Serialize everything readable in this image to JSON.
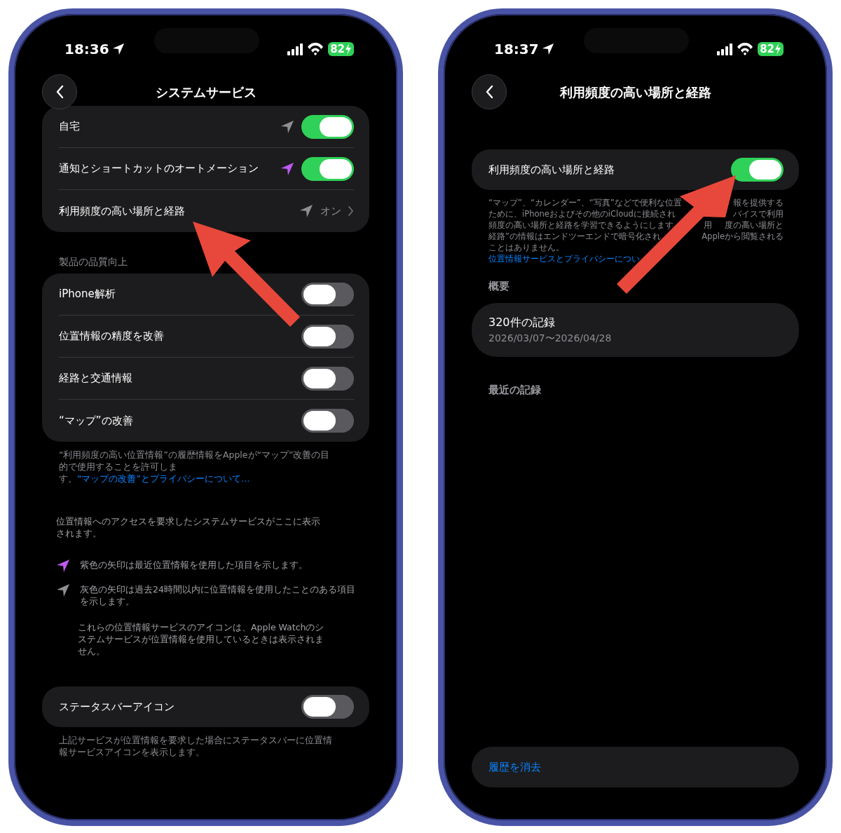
{
  "left_screen": {
    "status_bar": {
      "time": "18:36",
      "battery": "82"
    },
    "title": "システムサービス",
    "services": [
      {
        "label": "自宅",
        "color": "#8e8e93",
        "kind": "toggle",
        "on": true
      },
      {
        "label": "通知とショートカットのオートメーション",
        "color": "#bf5af2",
        "kind": "toggle",
        "on": true
      },
      {
        "label": "利用頻度の高い場所と経路",
        "color": "#8e8e93",
        "kind": "detail",
        "value": "オン"
      }
    ],
    "product_improvement": {
      "header": "製品の品質向上",
      "rows": [
        {
          "label": "iPhone解析",
          "on": false
        },
        {
          "label": "位置情報の精度を改善",
          "on": false
        },
        {
          "label": "経路と交通情報",
          "on": false
        },
        {
          "label": "“マップ”の改善",
          "on": false
        }
      ],
      "footer": "“利用頻度の高い位置情報”の履歴情報をAppleが“マップ”改善の目的で使用することを許可します。",
      "footer_link": "“マップの改善”とプライバシーについて…"
    },
    "info": "位置情報へのアクセスを要求したシステムサービスがここに表示されます。",
    "legend": [
      {
        "color": "#bf5af2",
        "text": "紫色の矢印は最近位置情報を使用した項目を示します。"
      },
      {
        "color": "#8e8e93",
        "text": "灰色の矢印は過去24時間以内に位置情報を使用したことのある項目を示します。"
      }
    ],
    "note": "これらの位置情報サービスのアイコンは、Apple Watchのシステムサービスが位置情報を使用しているときは表示されません。",
    "status_bar_icon": {
      "label": "ステータスバーアイコン",
      "on": false,
      "footer": "上記サービスが位置情報を要求した場合にステータスバーに位置情報サービスアイコンを表示します。"
    }
  },
  "right_screen": {
    "status_bar": {
      "time": "18:37",
      "battery": "82"
    },
    "title": "利用頻度の高い場所と経路",
    "toggle": {
      "label": "利用頻度の高い場所と経路",
      "on": true
    },
    "description_lines": [
      {
        "parts": [
          "“マップ”、“カレンダー”、“写真”などで便利な位置",
          "報を提供する"
        ]
      },
      {
        "parts": [
          "ために、iPhoneおよびその他のiCloudに接続され",
          "バイスで利用"
        ]
      },
      {
        "parts": [
          "頻度の高い場所と経路を学習できるようにします",
          "用",
          "度の高い場所と"
        ]
      },
      {
        "parts": [
          "経路”の情報はエンドツーエンドで暗号化され",
          "Appleから閲覧される"
        ]
      },
      {
        "parts": [
          "ことはありません。"
        ]
      }
    ],
    "description_link": "位置情報サービスとプライバシーについ",
    "summary_header": "概要",
    "summary": {
      "title": "320件の記録",
      "dates": "2026/03/07〜2026/04/28"
    },
    "recent_header": "最近の記録",
    "clear_button": "履歴を消去"
  }
}
